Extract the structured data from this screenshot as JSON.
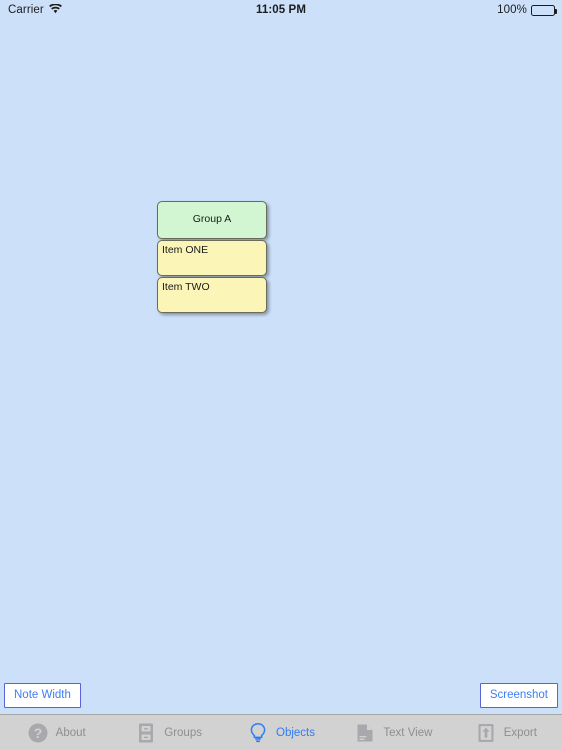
{
  "status_bar": {
    "carrier": "Carrier",
    "wifi_icon": "wifi-icon",
    "time": "11:05 PM",
    "battery_percent": "100%",
    "battery_icon": "battery-full-icon"
  },
  "canvas": {
    "background_color": "#cce0fa",
    "notes": [
      {
        "kind": "group",
        "label": "Group A",
        "color": "#d2f5d2",
        "align": "center"
      },
      {
        "kind": "item",
        "label": "Item ONE",
        "color": "#fbf5b8",
        "align": "left"
      },
      {
        "kind": "item",
        "label": "Item TWO",
        "color": "#fbf5b8",
        "align": "left"
      }
    ]
  },
  "buttons": {
    "note_width": "Note Width",
    "screenshot": "Screenshot",
    "border_color": "#5b63d8",
    "text_color": "#3d7ff0"
  },
  "tab_bar": {
    "active_color": "#2f7df6",
    "inactive_color": "#8e8e93",
    "background_color": "#d2d2d2",
    "items": [
      {
        "label": "About",
        "icon": "question-circle-icon",
        "active": false
      },
      {
        "label": "Groups",
        "icon": "file-cabinet-icon",
        "active": false
      },
      {
        "label": "Objects",
        "icon": "lightbulb-icon",
        "active": true
      },
      {
        "label": "Text View",
        "icon": "document-page-icon",
        "active": false
      },
      {
        "label": "Export",
        "icon": "export-up-arrow-icon",
        "active": false
      }
    ]
  }
}
